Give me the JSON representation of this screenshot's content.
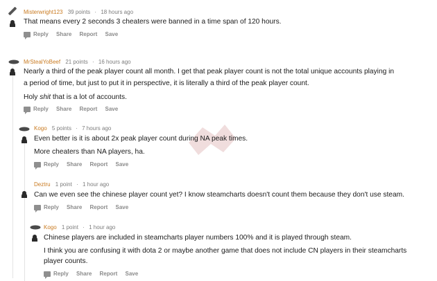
{
  "comments": [
    {
      "user": "Misterwright123",
      "points": "39 points",
      "sep": "·",
      "time": "18 hours ago",
      "body": [
        "That means every 2 seconds 3 cheaters were banned in a time span of 120 hours."
      ],
      "actions": {
        "reply": "Reply",
        "share": "Share",
        "report": "Report",
        "save": "Save"
      }
    },
    {
      "user": "MrStealYoBeef",
      "points": "21 points",
      "sep": "·",
      "time": "16 hours ago",
      "body": [
        "Nearly a third of the peak player count all month. I get that peak player count is not the total unique accounts playing in",
        "a period of time, but just to put it in perspective, it is literally a third of the peak player count."
      ],
      "body2_pre": "Holy ",
      "body2_em": "shit",
      "body2_post": " that is a lot of accounts.",
      "actions": {
        "reply": "Reply",
        "share": "Share",
        "report": "Report",
        "save": "Save"
      }
    },
    {
      "user": "Kogo",
      "points": "5 points",
      "sep": "·",
      "time": "7 hours ago",
      "body": [
        "Even better is it is about 2x peak player count during NA peak times.",
        "More cheaters than NA players, ha."
      ],
      "actions": {
        "reply": "Reply",
        "share": "Share",
        "report": "Report",
        "save": "Save"
      }
    },
    {
      "user": "Deztru",
      "points": "1 point",
      "sep": "·",
      "time": "1 hour ago",
      "body": [
        "Can we even see the chinese player count yet? I know steamcharts doesn't count them because they don't use steam."
      ],
      "actions": {
        "reply": "Reply",
        "share": "Share",
        "report": "Report",
        "save": "Save"
      }
    },
    {
      "user": "Kogo",
      "points": "1 point",
      "sep": "·",
      "time": "1 hour ago",
      "body": [
        "Chinese players are included in steamcharts player numbers 100% and it is played through steam.",
        "I think you are confusing it with dota 2 or maybe another game that does not include CN players in their steamcharts",
        "player counts."
      ],
      "actions": {
        "reply": "Reply",
        "share": "Share",
        "report": "Report",
        "save": "Save"
      }
    }
  ]
}
